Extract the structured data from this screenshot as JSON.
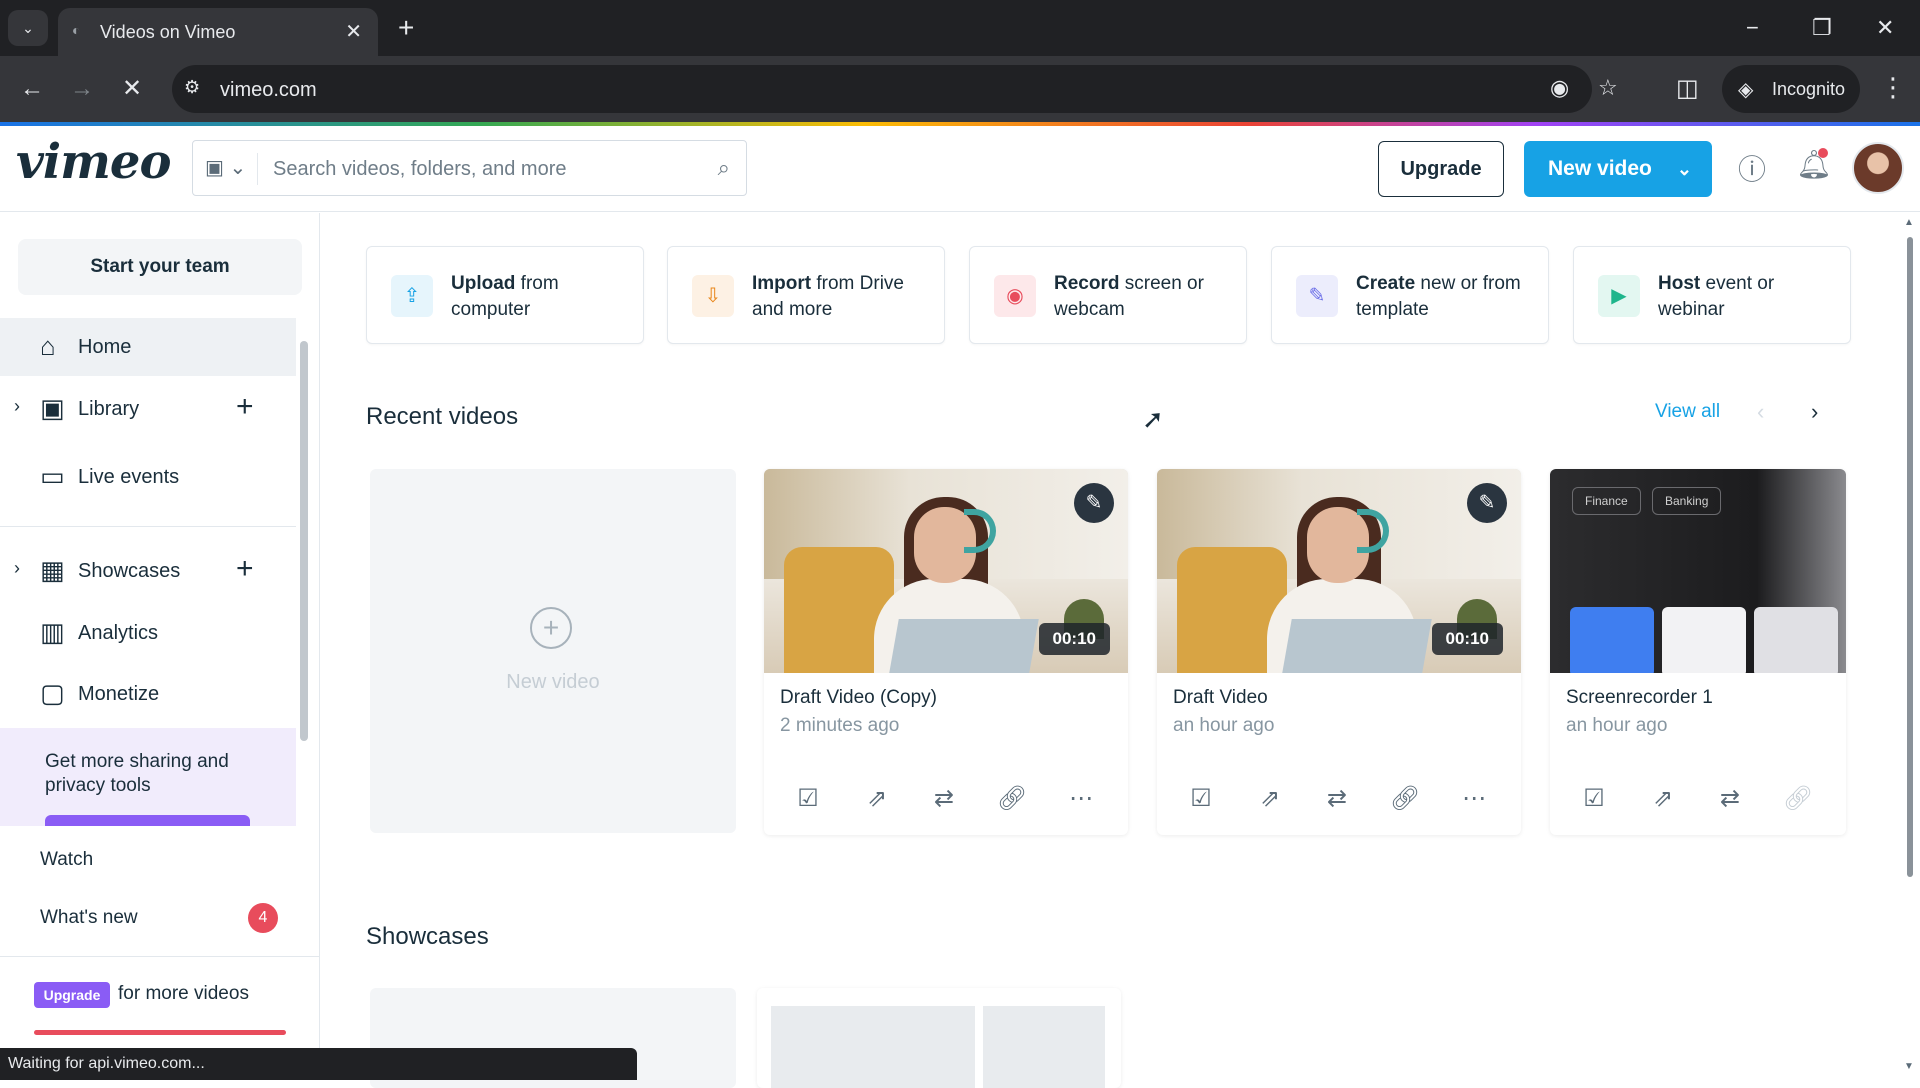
{
  "browser": {
    "tab_title": "Videos on Vimeo",
    "url": "vimeo.com",
    "incognito_label": "Incognito",
    "status_text": "Waiting for api.vimeo.com..."
  },
  "header": {
    "logo": "vimeo",
    "search_placeholder": "Search videos, folders, and more",
    "upgrade_label": "Upgrade",
    "new_video_label": "New video"
  },
  "sidebar": {
    "start_team": "Start your team",
    "items": [
      {
        "label": "Home",
        "icon": "home-icon"
      },
      {
        "label": "Library",
        "icon": "library-icon"
      },
      {
        "label": "Live events",
        "icon": "camera-icon"
      },
      {
        "label": "Showcases",
        "icon": "showcase-icon"
      },
      {
        "label": "Analytics",
        "icon": "analytics-icon"
      },
      {
        "label": "Monetize",
        "icon": "monetize-icon"
      }
    ],
    "promo_text": "Get more sharing and privacy tools",
    "watch": "Watch",
    "whats_new": "What's new",
    "whats_new_count": "4",
    "upgrade_badge": "Upgrade",
    "upgrade_text": "for more videos"
  },
  "quick_actions": [
    {
      "bold": "Upload",
      "rest": " from computer",
      "icon": "upload-icon",
      "color": "#17a2e5",
      "bg": "#e6f5fc"
    },
    {
      "bold": "Import",
      "rest": " from Drive and more",
      "icon": "download-icon",
      "color": "#e8861a",
      "bg": "#fdf1e4"
    },
    {
      "bold": "Record",
      "rest": " screen or webcam",
      "icon": "record-icon",
      "color": "#e84c5c",
      "bg": "#fde8ea"
    },
    {
      "bold": "Create",
      "rest": " new or from template",
      "icon": "create-icon",
      "color": "#6b6ee8",
      "bg": "#ecedfc"
    },
    {
      "bold": "Host",
      "rest": " event or webinar",
      "icon": "host-icon",
      "color": "#1fb58c",
      "bg": "#e3f7f1"
    }
  ],
  "recent": {
    "title": "Recent videos",
    "view_all": "View all",
    "new_video_label": "New video",
    "videos": [
      {
        "title": "Draft Video (Copy)",
        "time": "2 minutes ago",
        "duration": "00:10"
      },
      {
        "title": "Draft Video",
        "time": "an hour ago",
        "duration": "00:10"
      },
      {
        "title": "Screenrecorder 1",
        "time": "an hour ago",
        "chips": [
          "Finance",
          "Banking"
        ]
      }
    ]
  },
  "showcases": {
    "title": "Showcases"
  }
}
